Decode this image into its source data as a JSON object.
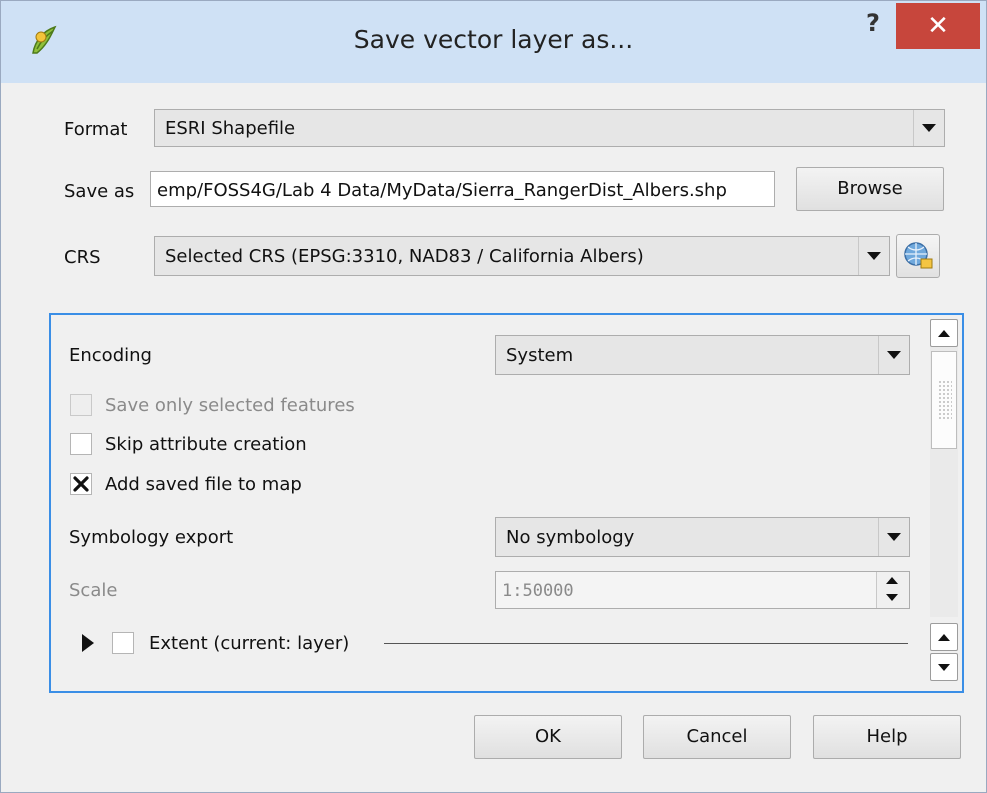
{
  "window": {
    "title": "Save vector layer as...",
    "help_label": "?",
    "close_label": "✕"
  },
  "form": {
    "format_label": "Format",
    "format_value": "ESRI Shapefile",
    "saveas_label": "Save as",
    "saveas_value": "emp/FOSS4G/Lab 4 Data/MyData/Sierra_RangerDist_Albers.shp",
    "browse_label": "Browse",
    "crs_label": "CRS",
    "crs_value": "Selected CRS (EPSG:3310, NAD83 / California Albers)"
  },
  "options": {
    "encoding_label": "Encoding",
    "encoding_value": "System",
    "save_selected_label": "Save only selected features",
    "save_selected_checked": false,
    "save_selected_enabled": false,
    "skip_attr_label": "Skip attribute creation",
    "skip_attr_checked": false,
    "add_map_label": "Add saved file to map",
    "add_map_checked": true,
    "symbology_label": "Symbology export",
    "symbology_value": "No symbology",
    "scale_label": "Scale",
    "scale_value": "1:50000",
    "extent_label": "Extent (current: layer)"
  },
  "buttons": {
    "ok": "OK",
    "cancel": "Cancel",
    "help": "Help"
  },
  "icons": {
    "app": "qgis-icon",
    "crs": "crs-globe-icon",
    "close": "close-icon",
    "checkmark": "checkmark-icon",
    "expand": "expand-arrow-icon"
  },
  "colors": {
    "focus_border": "#3a8ee6",
    "close_button": "#c7463c",
    "titlebar": "#cfe1f5"
  }
}
